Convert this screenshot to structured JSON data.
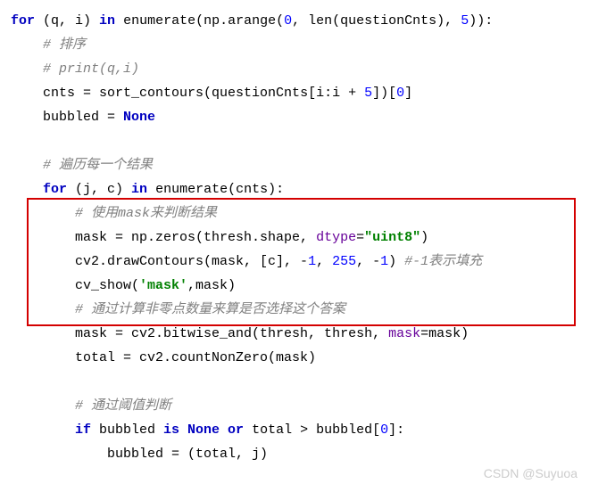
{
  "code": {
    "l1": {
      "a": "for",
      "b": " (q, i) ",
      "c": "in",
      "d": " ",
      "e": "enumerate",
      "f": "(np.arange(",
      "g": "0",
      "h": ", ",
      "i": "len",
      "j": "(questionCnts), ",
      "k": "5",
      "l": ")):"
    },
    "l2": "# 排序",
    "l3": "# print(q,i)",
    "l4": {
      "a": "cnts = sort_contours(questionCnts[i:i + ",
      "b": "5",
      "c": "])[",
      "d": "0",
      "e": "]"
    },
    "l5": {
      "a": "bubbled = ",
      "b": "None"
    },
    "l6": "",
    "l7": "# 遍历每一个结果",
    "l8": {
      "a": "for",
      "b": " (j, c) ",
      "c": "in",
      "d": " ",
      "e": "enumerate",
      "f": "(cnts):"
    },
    "l9": "# 使用mask来判断结果",
    "l10": {
      "a": "mask = np.zeros(thresh.shape, ",
      "b": "dtype",
      "c": "=",
      "d": "\"uint8\"",
      "e": ")"
    },
    "l11": {
      "a": "cv2.drawContours(mask, [c], -",
      "b": "1",
      "c": ", ",
      "d": "255",
      "e": ", -",
      "f": "1",
      "g": ") ",
      "h": "#-1表示填充"
    },
    "l12": {
      "a": "cv_show(",
      "b": "'mask'",
      "c": ",mask)"
    },
    "l13": "# 通过计算非零点数量来算是否选择这个答案",
    "l14": {
      "a": "mask = cv2.bitwise_and(thresh, thresh, ",
      "b": "mask",
      "c": "=mask)"
    },
    "l15": "total = cv2.countNonZero(mask)",
    "l16": "",
    "l17": "# 通过阈值判断",
    "l18": {
      "a": "if",
      "b": " bubbled ",
      "c": "is None or",
      "d": " total > bubbled[",
      "e": "0",
      "f": "]:"
    },
    "l19": "bubbled = (total, j)"
  },
  "watermark": "CSDN @Suyuoa"
}
